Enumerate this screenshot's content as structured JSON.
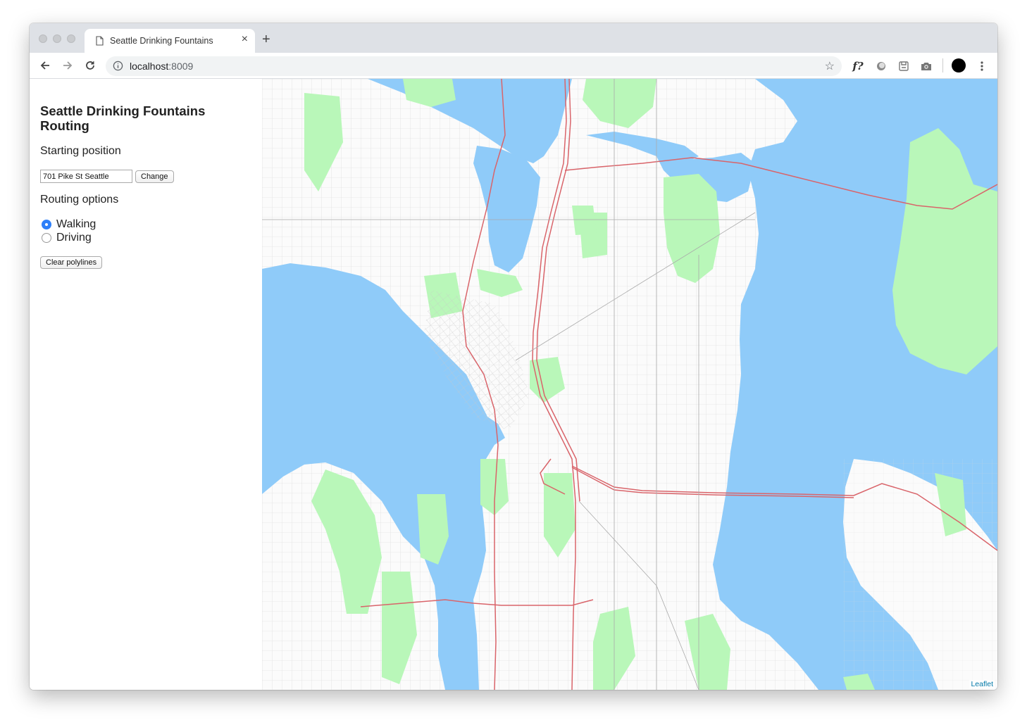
{
  "browser": {
    "tab_title": "Seattle Drinking Fountains",
    "new_tab_symbol": "+",
    "close_symbol": "×",
    "url_host": "localhost",
    "url_port": ":8009",
    "extensions": [
      "formula-icon",
      "toggle-icon",
      "page-save-icon",
      "camera-icon"
    ],
    "extension_formula_label": "f?"
  },
  "sidebar": {
    "title": "Seattle Drinking Fountains Routing",
    "starting_position_heading": "Starting position",
    "address_value": "701 Pike St Seattle",
    "change_button": "Change",
    "routing_options_heading": "Routing options",
    "routing_options": [
      {
        "label": "Walking",
        "checked": true
      },
      {
        "label": "Driving",
        "checked": false
      }
    ],
    "clear_button": "Clear polylines"
  },
  "map": {
    "attribution": "Leaflet",
    "colors": {
      "water": "#8fcbf9",
      "park": "#b9f7b9",
      "land": "#fbfbfb",
      "highway": "#d9646a",
      "street": "#bfbfbf"
    }
  }
}
